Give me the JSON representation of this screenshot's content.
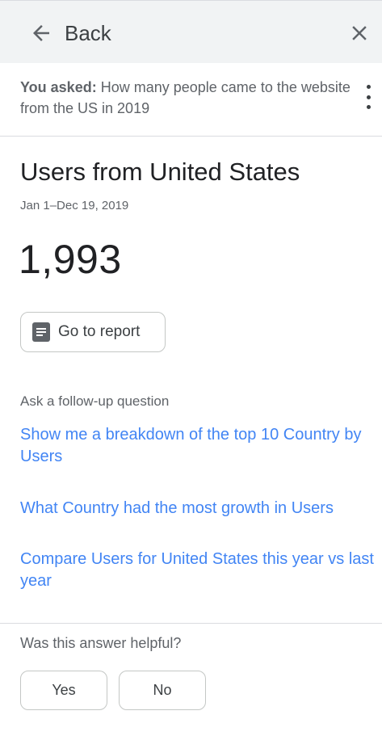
{
  "header": {
    "back_label": "Back",
    "back_icon": "arrow-left-icon",
    "close_icon": "close-icon"
  },
  "query": {
    "label": "You asked:",
    "text": "How many people came to the website from the US in 2019",
    "menu_icon": "more-vert-icon"
  },
  "answer": {
    "title": "Users from United States",
    "date_range": "Jan 1–Dec 19, 2019",
    "value": "1,993",
    "report_button": "Go to report",
    "report_icon": "report-document-icon"
  },
  "followup": {
    "label": "Ask a follow-up question",
    "suggestions": [
      "Show me a breakdown of the top 10 Country by Users",
      "What Country had the most growth in Users",
      "Compare Users for United States this year vs last year"
    ]
  },
  "feedback": {
    "question": "Was this answer helpful?",
    "yes_label": "Yes",
    "no_label": "No"
  },
  "colors": {
    "link": "#4285f4",
    "header_bg": "#f1f3f4",
    "text_primary": "#202124",
    "text_secondary": "#5f6368"
  }
}
